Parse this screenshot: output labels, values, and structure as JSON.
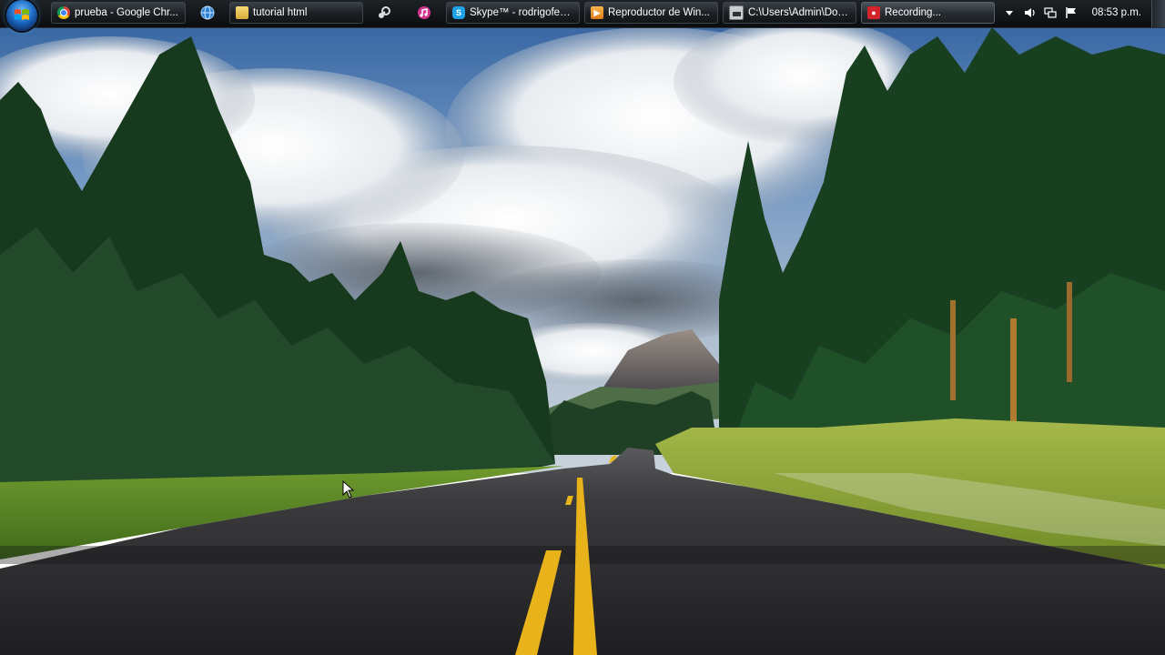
{
  "taskbar": {
    "start_button": "start-orb",
    "windows": [
      {
        "label": "prueba - Google Chr...",
        "icon": "chrome-icon",
        "color": "#e2452f"
      },
      {
        "label": "tutorial html",
        "icon": "folder-icon",
        "color": "#e8c650"
      },
      {
        "label": "Skype™ - rodrigofer1...",
        "icon": "skype-icon",
        "color": "#1ea3e6"
      },
      {
        "label": "Reproductor de Win...",
        "icon": "media-player-icon",
        "color": "#f29a2e"
      },
      {
        "label": "C:\\Users\\Admin\\Doc...",
        "icon": "console-icon",
        "color": "#c8ccd0"
      },
      {
        "label": "Recording...",
        "icon": "recording-icon",
        "color": "#d2222a"
      }
    ],
    "quick_launch": [
      {
        "icon": "network-globe-icon"
      },
      {
        "icon": "steam-icon"
      },
      {
        "icon": "itunes-icon"
      }
    ],
    "tray": {
      "icons": [
        "tray-overflow-icon",
        "volume-icon",
        "network-icon",
        "flag-icon"
      ],
      "clock": "08:53 p.m."
    }
  }
}
